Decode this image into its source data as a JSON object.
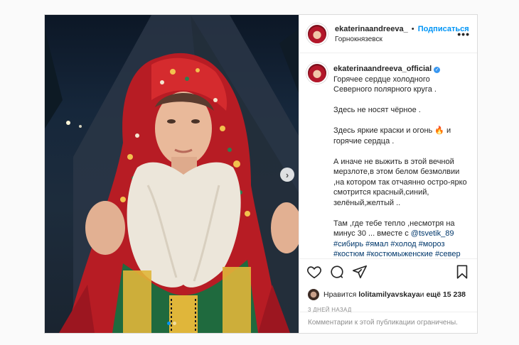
{
  "post": {
    "header": {
      "username": "ekaterinaandreeva_",
      "separator": "•",
      "follow_label": "Подписаться",
      "location": "Горнокнязевск",
      "more_label": "•••"
    },
    "caption": {
      "username": "ekaterinaandreeva_official",
      "verified_label": "✓",
      "paragraphs": [
        "Горячее сердце холодного Северного полярного круга .",
        "Здесь не носят чёрное .",
        "Здесь яркие краски и огонь 🔥 и горячие сердца .",
        "А иначе не выжить в этой вечной мерзлоте,в этом белом безмолвии ,на котором так отчаянно остро-ярко смотрится красный,синий, зелёный,желтый .."
      ],
      "last_text": "Там ,где тебе тепло ,несмотря на минус 30 ... вместе с ",
      "mention": "@tsvetik_89",
      "hashtags_line1": "#сибирь #ямал #холод #мороз",
      "hashtags_line2": "#костюм #костюмыженские #север"
    },
    "likes": {
      "prefix": "Нравится ",
      "liker": "lolitamilyavskaya",
      "middle": " и ",
      "others": "ещё 15 238"
    },
    "date": "3 ДНЕЙ НАЗАД",
    "comments_disabled": "Комментарии к этой публикации ограничены.",
    "media": {
      "next_label": "›",
      "carousel_count": 2,
      "active_index": 0
    }
  },
  "icons": [
    "heart-icon",
    "comment-icon",
    "share-icon",
    "bookmark-icon"
  ]
}
